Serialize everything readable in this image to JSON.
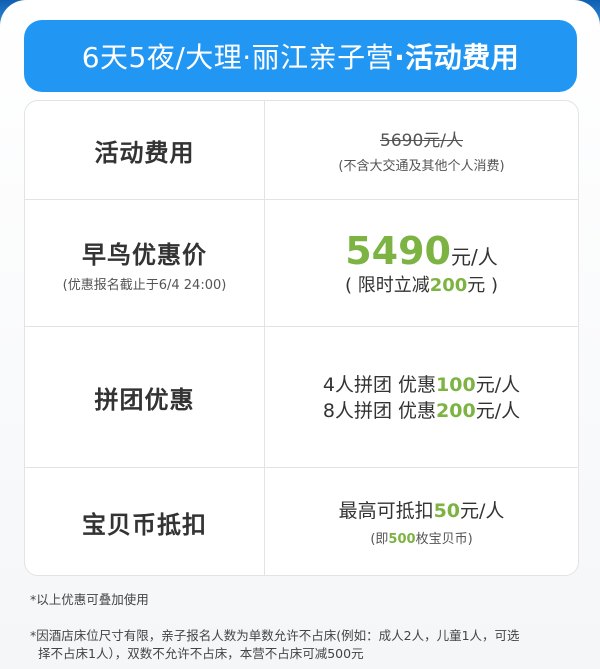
{
  "title": {
    "plain": "6天5夜/大理·丽江亲子营",
    "bold": "·活动费用"
  },
  "rows": {
    "fee": {
      "label": "活动费用",
      "original_price": "5690元/人",
      "note": "(不含大交通及其他个人消费)"
    },
    "early_bird": {
      "label": "早鸟优惠价",
      "deadline": "(优惠报名截止于6/4 24:00)",
      "price": "5490",
      "unit": "元/人",
      "limit_prefix": "( 限时立减",
      "limit_amount": "200",
      "limit_suffix": "元 )"
    },
    "group": {
      "label": "拼团优惠",
      "line1_prefix": "4人拼团 优惠",
      "line1_amount": "100",
      "line1_suffix": "元/人",
      "line2_prefix": "8人拼团 优惠",
      "line2_amount": "200",
      "line2_suffix": "元/人"
    },
    "coins": {
      "label": "宝贝币抵扣",
      "line_prefix": "最高可抵扣",
      "line_amount": "50",
      "line_suffix": "元/人",
      "sub_prefix": "(即",
      "sub_amount": "500",
      "sub_suffix": "枚宝贝币)"
    }
  },
  "notes": {
    "note1": "*以上优惠可叠加使用",
    "note2_line1": "*因酒店床位尺寸有限，亲子报名人数为单数允许不占床(例如：成人2人，儿童1人，可选",
    "note2_line2": "择不占床1人），双数不允许不占床，本营不占床可减500元"
  },
  "colors": {
    "title_bg": "#2196f3",
    "accent_green": "#7cb342"
  }
}
